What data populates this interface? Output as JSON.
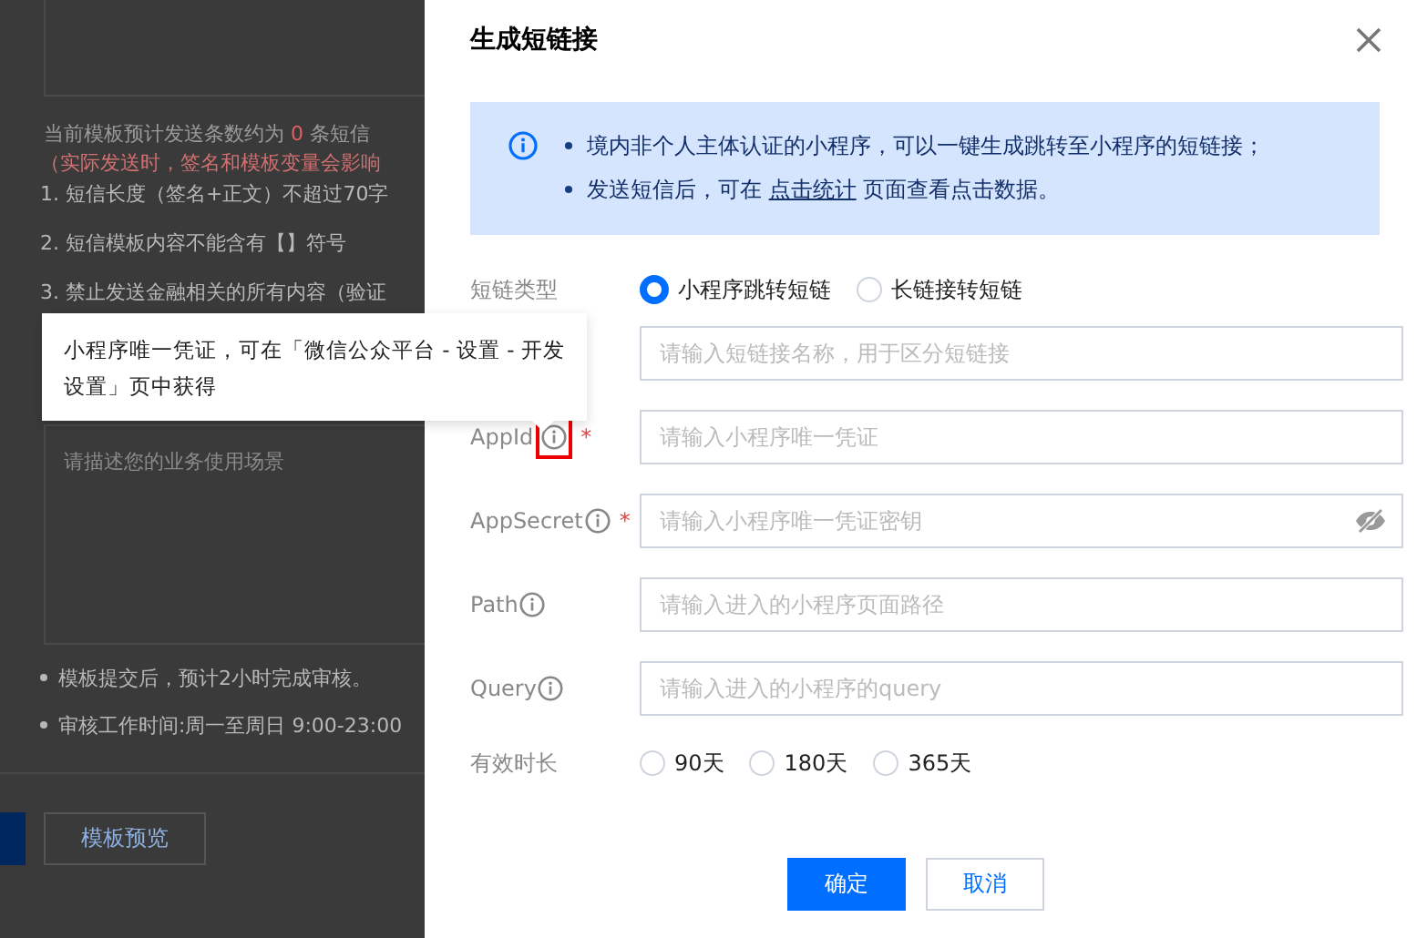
{
  "background_page": {
    "estimate": {
      "before": "当前模板预计发送条数约为 ",
      "count": "0",
      "after": " 条短信"
    },
    "note": "（实际发送时，签名和模板变量会影响",
    "rules": [
      "1. 短信长度（签名+正文）不超过70字",
      "2. 短信模板内容不能含有【】符号",
      "3. 禁止发送金融相关的所有内容（验证"
    ],
    "scenario_placeholder": "请描述您的业务使用场景",
    "tips": [
      "模板提交后，预计2小时完成审核。",
      "审核工作时间:周一至周日 9:00-23:00"
    ],
    "buttons": [
      "模板预览"
    ]
  },
  "tooltip": {
    "text": "小程序唯一凭证，可在「微信公众平台 - 设置 - 开发设置」页中获得"
  },
  "dialog": {
    "title": "生成短链接",
    "notice": [
      {
        "text": "境内非个人主体认证的小程序，可以一键生成跳转至小程序的短链接；"
      },
      {
        "before": "发送短信后，可在 ",
        "link": "点击统计",
        "after": " 页面查看点击数据。"
      }
    ],
    "rows": [
      {
        "kind": "radio",
        "label": "短链类型",
        "options": [
          {
            "label": "小程序跳转短链",
            "selected": true
          },
          {
            "label": "长链接转短链",
            "selected": false
          }
        ]
      },
      {
        "kind": "input",
        "placeholder": "请输入短链接名称，用于区分短链接",
        "info": false
      },
      {
        "kind": "input",
        "label": "AppId",
        "placeholder": "请输入小程序唯一凭证",
        "info": true,
        "required_mark": "*",
        "highlighted": true
      },
      {
        "kind": "password",
        "label": "AppSecret",
        "placeholder": "请输入小程序唯一凭证密钥",
        "info": true,
        "required_mark": "*"
      },
      {
        "kind": "input",
        "label": "Path",
        "placeholder": "请输入进入的小程序页面路径",
        "info": true
      },
      {
        "kind": "input",
        "label": "Query",
        "placeholder": "请输入进入的小程序的query",
        "info": true
      },
      {
        "kind": "radio",
        "label": "有效时长",
        "options": [
          {
            "label": "90天",
            "selected": false
          },
          {
            "label": "180天",
            "selected": false
          },
          {
            "label": "365天",
            "selected": false
          }
        ]
      }
    ],
    "buttons": [
      {
        "label": "确定",
        "kind": "primary"
      },
      {
        "label": "取消",
        "kind": "secondary"
      }
    ]
  }
}
